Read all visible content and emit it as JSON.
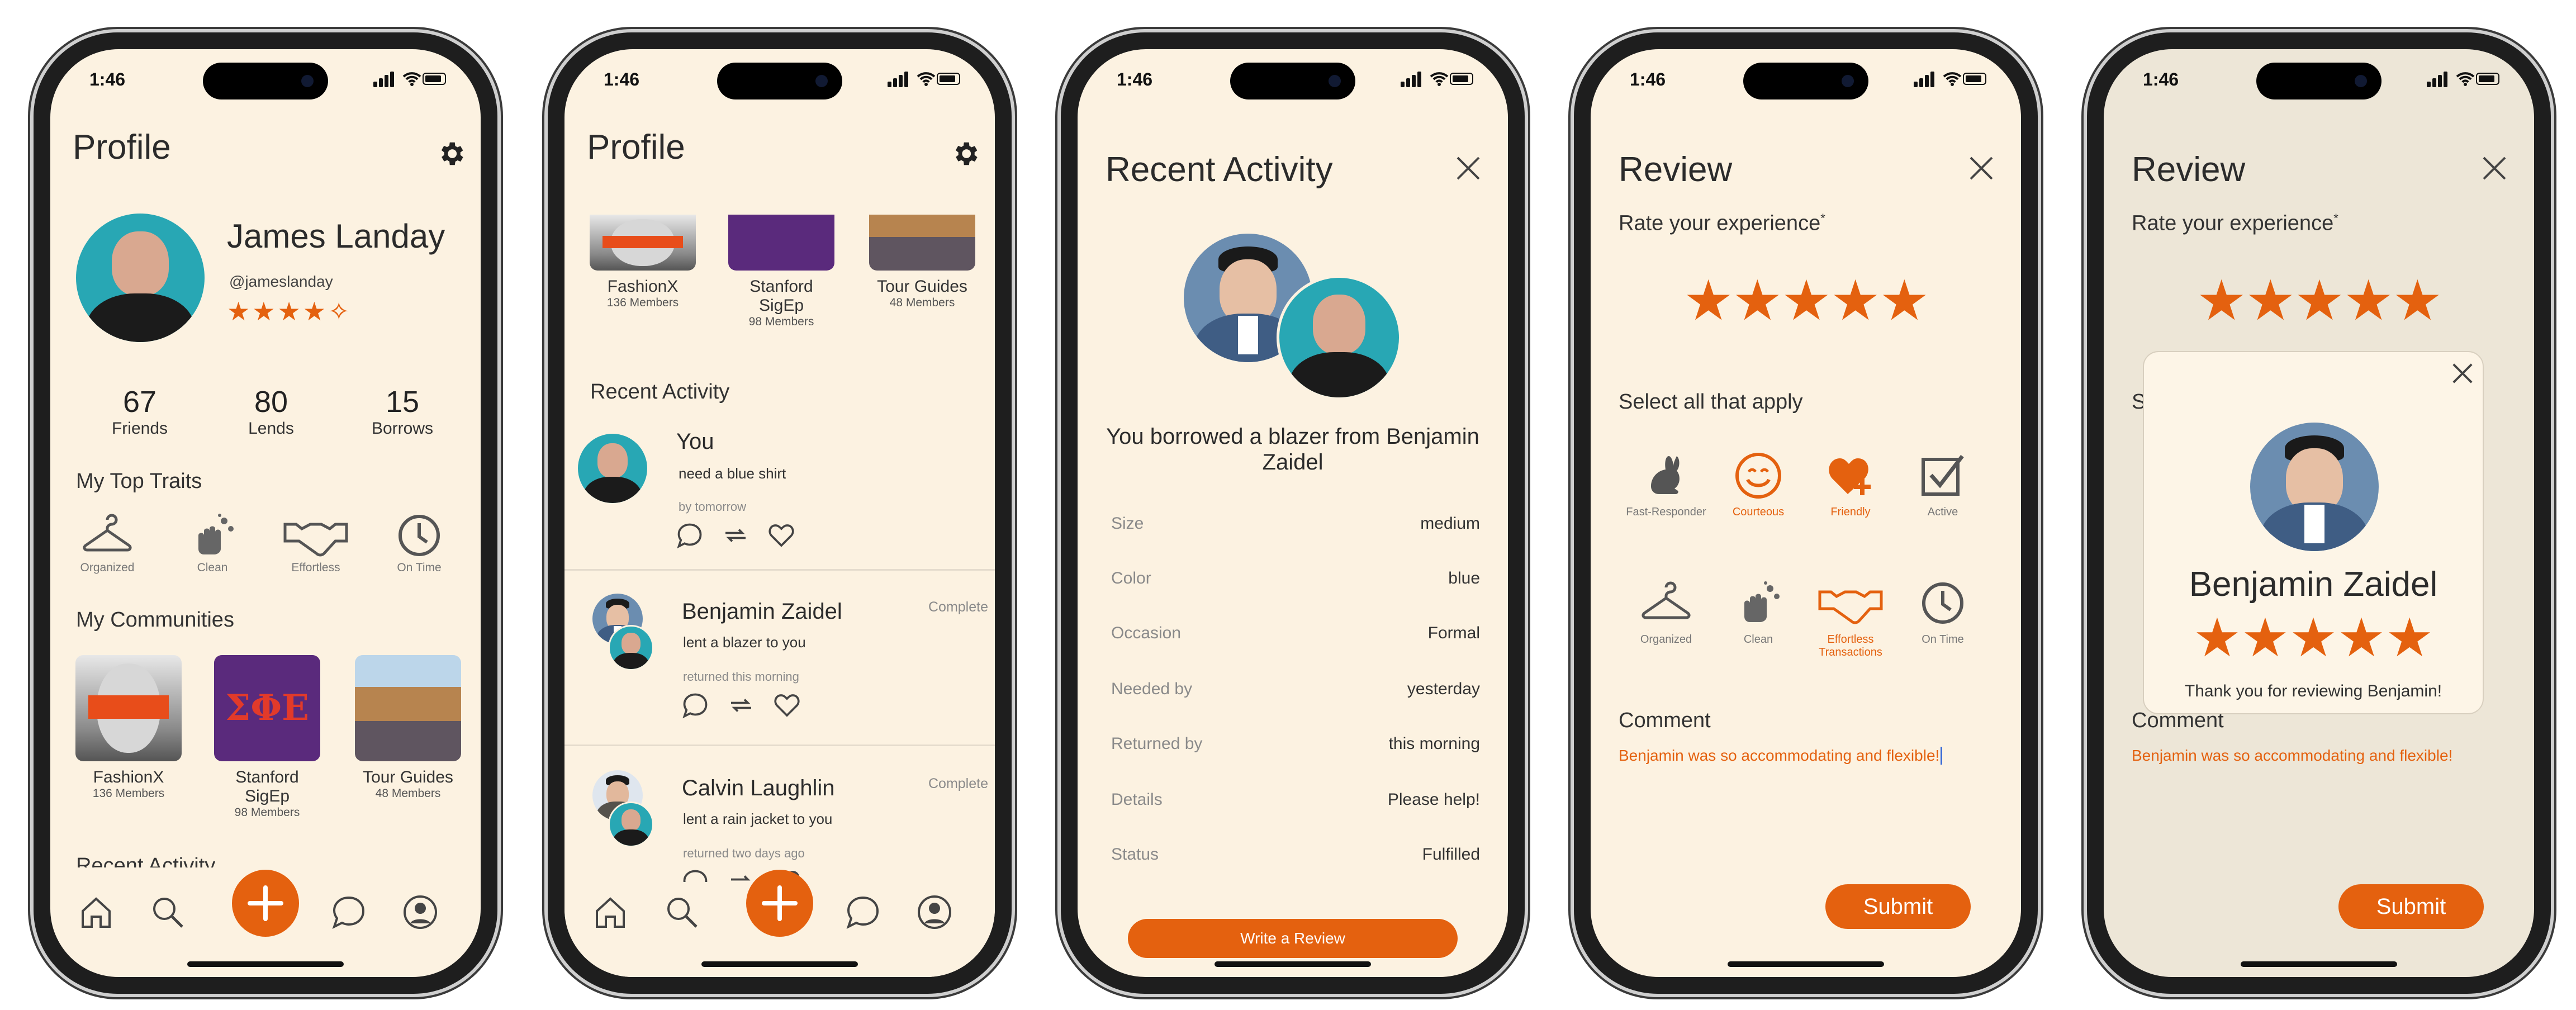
{
  "status_bar": {
    "time": "1:46"
  },
  "nav": {
    "icons": [
      "home-icon",
      "search-icon",
      "plus-icon",
      "chat-icon",
      "profile-icon"
    ]
  },
  "screen1": {
    "title": "Profile",
    "name": "James Landay",
    "handle": "@jameslanday",
    "rating_stars": 4.5,
    "stats": [
      {
        "value": "67",
        "label": "Friends"
      },
      {
        "value": "80",
        "label": "Lends"
      },
      {
        "value": "15",
        "label": "Borrows"
      }
    ],
    "traits_heading": "My Top Traits",
    "traits": [
      {
        "label": "Organized",
        "icon": "hanger-icon"
      },
      {
        "label": "Clean",
        "icon": "sparkle-hand-icon"
      },
      {
        "label": "Effortless",
        "icon": "handshake-icon"
      },
      {
        "label": "On Time",
        "icon": "clock-icon"
      }
    ],
    "communities_heading": "My Communities",
    "communities": [
      {
        "name": "FashionX",
        "members": "136 Members"
      },
      {
        "name": "Stanford SigEp",
        "members": "98 Members"
      },
      {
        "name": "Tour Guides",
        "members": "48 Members"
      }
    ],
    "sigep_logo": "ΣΦΕ",
    "recent_cut": "Recent Activity"
  },
  "screen2": {
    "title": "Profile",
    "communities": [
      {
        "name": "FashionX",
        "members": "136 Members"
      },
      {
        "name": "Stanford SigEp",
        "members": "98 Members"
      },
      {
        "name": "Tour Guides",
        "members": "48 Members"
      }
    ],
    "recent_heading": "Recent Activity",
    "activities": [
      {
        "name": "You",
        "desc": "need a blue shirt",
        "when": "by tomorrow",
        "status": ""
      },
      {
        "name": "Benjamin Zaidel",
        "desc": "lent a blazer to you",
        "when": "returned this morning",
        "status": "Complete"
      },
      {
        "name": "Calvin Laughlin",
        "desc": "lent a rain jacket to you",
        "when": "returned two days ago",
        "status": "Complete"
      }
    ]
  },
  "screen3": {
    "title": "Recent Activity",
    "headline": "You borrowed a blazer from Benjamin Zaidel",
    "details": [
      {
        "key": "Size",
        "value": "medium"
      },
      {
        "key": "Color",
        "value": "blue"
      },
      {
        "key": "Occasion",
        "value": "Formal"
      },
      {
        "key": "Needed by",
        "value": "yesterday"
      },
      {
        "key": "Returned by",
        "value": "this morning"
      },
      {
        "key": "Details",
        "value": "Please help!"
      },
      {
        "key": "Status",
        "value": "Fulfilled"
      }
    ],
    "button": "Write a Review"
  },
  "screen4": {
    "title": "Review",
    "rate_label": "Rate your experience",
    "required_mark": "*",
    "rating": 5,
    "select_label": "Select all that apply",
    "traits": [
      {
        "label": "Fast-Responder",
        "selected": false
      },
      {
        "label": "Courteous",
        "selected": true
      },
      {
        "label": "Friendly",
        "selected": true
      },
      {
        "label": "Active",
        "selected": false
      },
      {
        "label": "Organized",
        "selected": false
      },
      {
        "label": "Clean",
        "selected": false
      },
      {
        "label": "Effortless Transactions",
        "selected": true
      },
      {
        "label": "On Time",
        "selected": false
      }
    ],
    "comment_label": "Comment",
    "comment": "Benjamin was so accommodating and flexible!",
    "submit": "Submit"
  },
  "screen5": {
    "title": "Review",
    "rate_label": "Rate your experience",
    "required_mark": "*",
    "select_cut": "S",
    "comment_label": "Comment",
    "comment": "Benjamin was so accommodating and flexible!",
    "submit": "Submit",
    "modal": {
      "name": "Benjamin Zaidel",
      "rating": 5,
      "message": "Thank you for reviewing Benjamin!"
    }
  },
  "colors": {
    "accent": "#e4610f",
    "background": "#fcf2e1",
    "teal": "#28a7b4"
  }
}
